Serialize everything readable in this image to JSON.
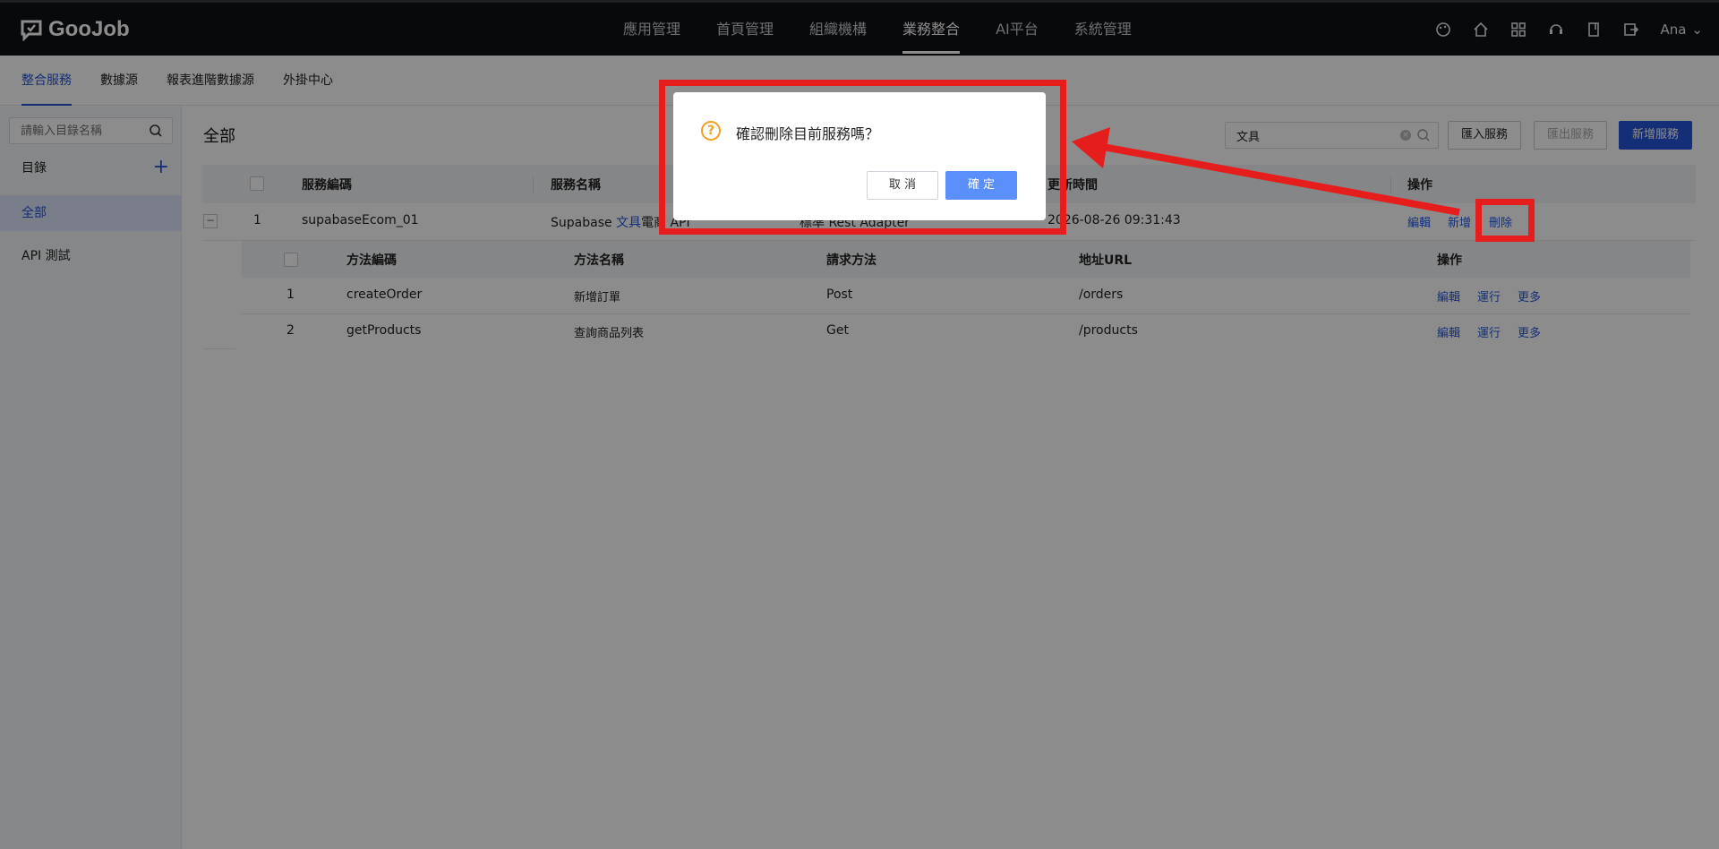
{
  "app": {
    "logo_text": "GooJob",
    "nav": [
      "應用管理",
      "首頁管理",
      "組織機構",
      "業務整合",
      "AI平台",
      "系統管理"
    ],
    "active_nav": "業務整合",
    "user": "Ana"
  },
  "subnav": {
    "items": [
      "整合服務",
      "數據源",
      "報表進階數據源",
      "外掛中心"
    ]
  },
  "sidebar": {
    "search_placeholder": "請輸入目錄名稱",
    "dir_label": "目錄",
    "items": [
      "全部",
      "API 測試"
    ]
  },
  "main": {
    "title": "全部",
    "filter_value": "文具",
    "buttons": {
      "import": "匯入服務",
      "export": "匯出服務",
      "add": "新增服務"
    },
    "columns": [
      "服務編碼",
      "服務名稱",
      "更新時間",
      "操作"
    ],
    "row": {
      "index": "1",
      "code": "supabaseEcom_01",
      "name_prefix": "Supabase ",
      "name_highlight": "文具",
      "name_suffix": "電商 API",
      "adapter": "標準 Rest Adapter",
      "updated": "2026-08-26 09:31:43",
      "actions": [
        "編輯",
        "新增",
        "刪除"
      ]
    },
    "sub_columns": [
      "方法編碼",
      "方法名稱",
      "請求方法",
      "地址URL",
      "操作"
    ],
    "sub_rows": [
      {
        "index": "1",
        "code": "createOrder",
        "name": "新增訂單",
        "method": "Post",
        "url": "/orders",
        "actions": [
          "編輯",
          "運行",
          "更多"
        ]
      },
      {
        "index": "2",
        "code": "getProducts",
        "name": "查詢商品列表",
        "method": "Get",
        "url": "/products",
        "actions": [
          "編輯",
          "運行",
          "更多"
        ]
      }
    ]
  },
  "dialog": {
    "message": "確認刪除目前服務嗎？",
    "cancel": "取 消",
    "confirm": "確 定"
  },
  "colors": {
    "accent": "#2656d9",
    "annotation": "#e51d1d",
    "warning": "#f0a020"
  }
}
